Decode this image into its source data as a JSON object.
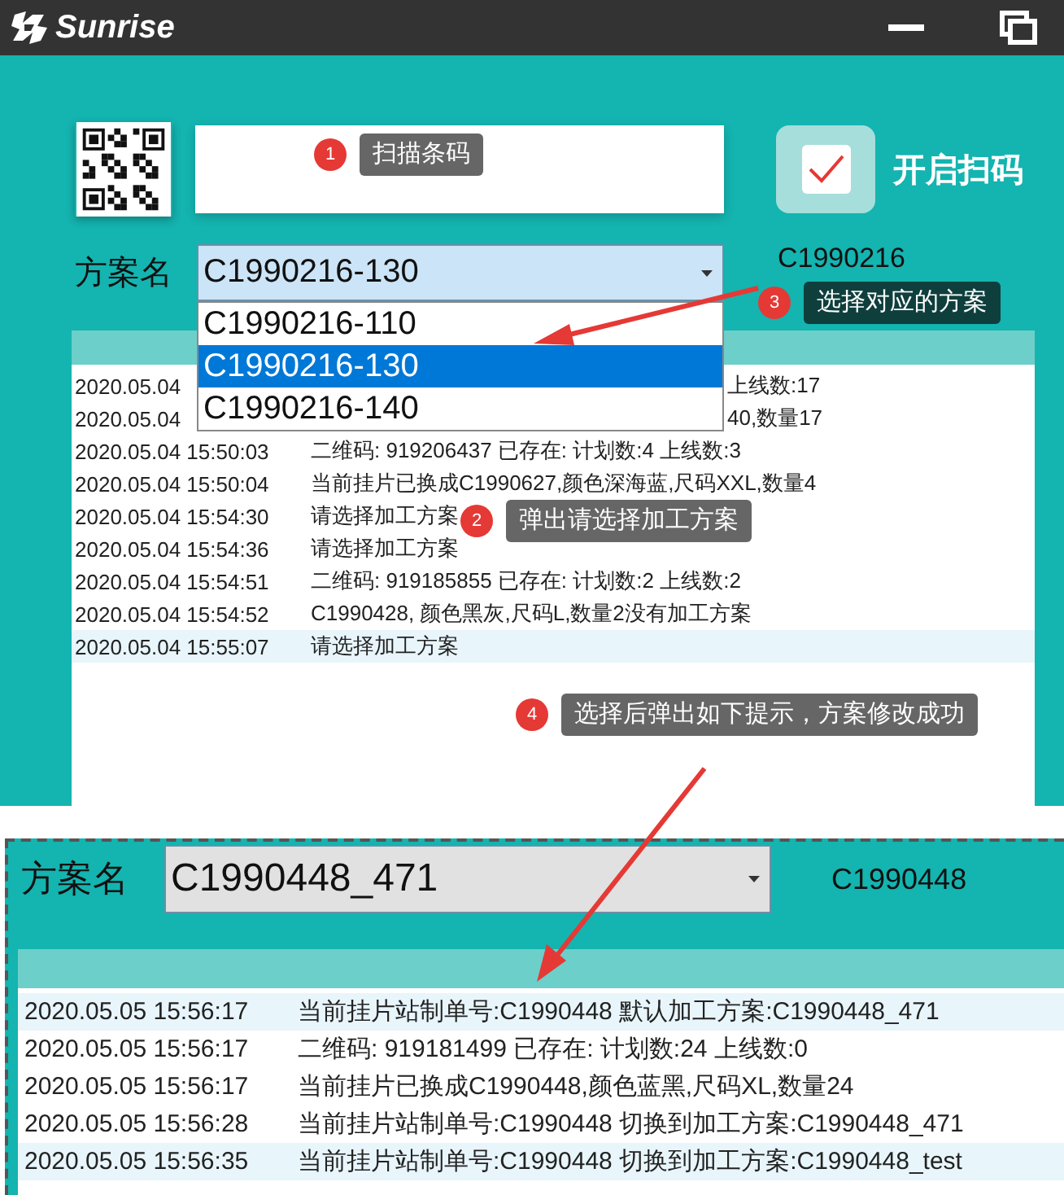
{
  "title_bar": {
    "app_name": "Sunrise"
  },
  "scan": {
    "button_label": "开启扫码",
    "checked": true
  },
  "scheme": {
    "label": "方案名",
    "value": "C1990216-130",
    "code": "C1990216",
    "options": [
      {
        "label": "C1990216-110",
        "selected": false
      },
      {
        "label": "C1990216-130",
        "selected": true
      },
      {
        "label": "C1990216-140",
        "selected": false
      }
    ]
  },
  "log": [
    {
      "kind": "covered",
      "time": "2020.05.04",
      "text": "上线数:17",
      "selected": false
    },
    {
      "kind": "covered",
      "time": "2020.05.04",
      "text": "40,数量17",
      "selected": false
    },
    {
      "kind": "full",
      "time": "2020.05.04 15:50:03",
      "text": "二维码: 919206437 已存在:  计划数:4  上线数:3",
      "selected": false
    },
    {
      "kind": "full",
      "time": "2020.05.04 15:50:04",
      "text": "当前挂片已换成C1990627,颜色深海蓝,尺码XXL,数量4",
      "selected": false
    },
    {
      "kind": "full",
      "time": "2020.05.04 15:54:30",
      "text": "请选择加工方案",
      "selected": false
    },
    {
      "kind": "full",
      "time": "2020.05.04 15:54:36",
      "text": "请选择加工方案",
      "selected": false
    },
    {
      "kind": "full",
      "time": "2020.05.04 15:54:51",
      "text": "二维码: 919185855 已存在:  计划数:2  上线数:2",
      "selected": false
    },
    {
      "kind": "full",
      "time": "2020.05.04 15:54:52",
      "text": "C1990428, 颜色黑灰,尺码L,数量2没有加工方案",
      "selected": false
    },
    {
      "kind": "full",
      "time": "2020.05.04 15:55:07",
      "text": "请选择加工方案",
      "selected": true
    }
  ],
  "result": {
    "label": "方案名",
    "value": "C1990448_471",
    "code": "C1990448",
    "log": [
      {
        "time": "2020.05.05 15:56:17",
        "text": "当前挂片站制单号:C1990448 默认加工方案:C1990448_471",
        "selected": true
      },
      {
        "time": "2020.05.05 15:56:17",
        "text": "二维码: 919181499 已存在:  计划数:24  上线数:0",
        "selected": false
      },
      {
        "time": "2020.05.05 15:56:17",
        "text": "当前挂片已换成C1990448,颜色蓝黑,尺码XL,数量24",
        "selected": false
      },
      {
        "time": "2020.05.05 15:56:28",
        "text": "当前挂片站制单号:C1990448 切换到加工方案:C1990448_471",
        "selected": false
      },
      {
        "time": "2020.05.05 15:56:35",
        "text": "当前挂片站制单号:C1990448 切换到加工方案:C1990448_test",
        "selected": true
      }
    ]
  },
  "callouts": [
    {
      "number": "1",
      "text": "扫描条码",
      "kind": "grey"
    },
    {
      "number": "2",
      "text": "弹出请选择加工方案",
      "kind": "grey"
    },
    {
      "number": "3",
      "text": "选择对应的方案",
      "kind": "dark"
    },
    {
      "number": "4",
      "text": "选择后弹出如下提示，方案修改成功",
      "kind": "grey"
    }
  ]
}
